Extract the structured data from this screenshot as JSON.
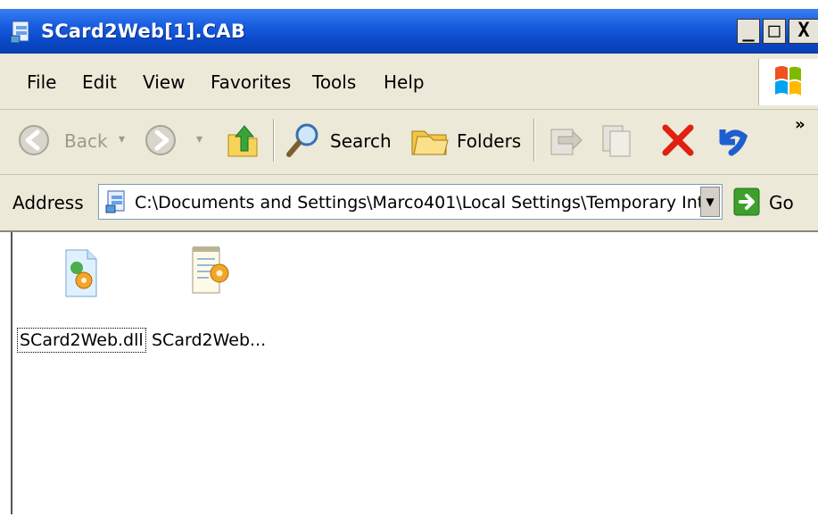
{
  "window": {
    "title": "SCard2Web[1].CAB",
    "controls": {
      "minimize": "_",
      "maximize": "□",
      "close": "X"
    }
  },
  "menu": {
    "items": [
      "File",
      "Edit",
      "View",
      "Favorites",
      "Tools",
      "Help"
    ]
  },
  "toolbar": {
    "back_label": "Back",
    "search_label": "Search",
    "folders_label": "Folders",
    "more_glyph": "»"
  },
  "address": {
    "label": "Address",
    "value": "C:\\Documents and Settings\\Marco401\\Local Settings\\Temporary Int",
    "go_label": "Go"
  },
  "files": [
    {
      "name": "SCard2Web.dll",
      "icon": "dll-file-icon",
      "focused": true
    },
    {
      "name": "SCard2Web...",
      "icon": "inf-settings-file-icon",
      "focused": false
    }
  ],
  "colors": {
    "titlebar": "#0a49c8",
    "chrome": "#ece9d8",
    "close_red": "#e02010",
    "go_green": "#3ca02a"
  }
}
